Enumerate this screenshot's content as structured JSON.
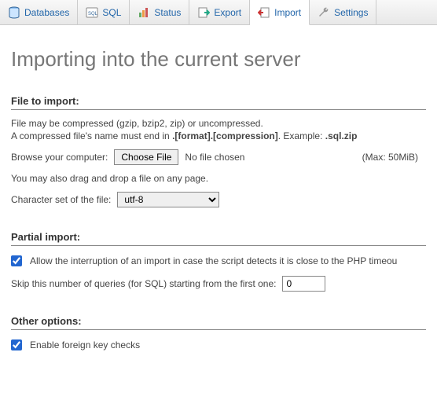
{
  "tabs": {
    "databases": "Databases",
    "sql": "SQL",
    "status": "Status",
    "export": "Export",
    "import": "Import",
    "settings": "Settings"
  },
  "page_title": "Importing into the current server",
  "file_section": {
    "title": "File to import:",
    "compressed_info": "File may be compressed (gzip, bzip2, zip) or uncompressed.",
    "name_rule_prefix": "A compressed file's name must end in ",
    "name_rule_format": ".[format].[compression]",
    "name_rule_example_label": ". Example: ",
    "name_rule_example": ".sql.zip",
    "browse_label": "Browse your computer:",
    "choose_file_btn": "Choose File",
    "no_file": "No file chosen",
    "max_size": "(Max: 50MiB)",
    "dragdrop": "You may also drag and drop a file on any page.",
    "charset_label": "Character set of the file:",
    "charset_value": "utf-8"
  },
  "partial": {
    "title": "Partial import:",
    "allow_interrupt": "Allow the interruption of an import in case the script detects it is close to the PHP timeou",
    "skip_label": "Skip this number of queries (for SQL) starting from the first one:",
    "skip_value": "0"
  },
  "other": {
    "title": "Other options:",
    "fk_checks": "Enable foreign key checks"
  }
}
